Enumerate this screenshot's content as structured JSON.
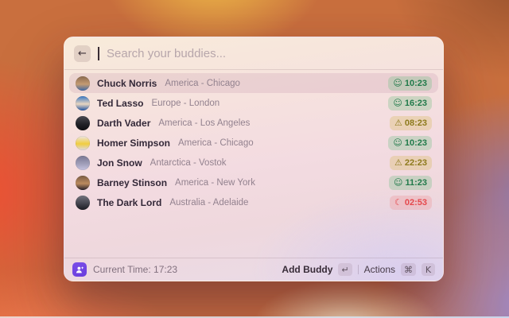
{
  "search": {
    "placeholder": "Search your buddies..."
  },
  "icons": {
    "back": "←",
    "happy": "☺",
    "warning": "⚠",
    "night": "☾"
  },
  "buddies": [
    {
      "name": "Chuck Norris",
      "location": "America - Chicago",
      "time": "10:23",
      "status": "happy",
      "selected": true,
      "avatar": [
        "#8a6a4e",
        "#c59b72",
        "#4068a4"
      ]
    },
    {
      "name": "Ted Lasso",
      "location": "Europe - London",
      "time": "16:23",
      "status": "happy",
      "selected": false,
      "avatar": [
        "#3a78c2",
        "#e8d5c0",
        "#2456a2"
      ]
    },
    {
      "name": "Darth Vader",
      "location": "America - Los Angeles",
      "time": "08:23",
      "status": "warning",
      "selected": false,
      "avatar": [
        "#4a4a52",
        "#222228",
        "#0e0e12"
      ]
    },
    {
      "name": "Homer Simpson",
      "location": "America - Chicago",
      "time": "10:23",
      "status": "happy",
      "selected": false,
      "avatar": [
        "#ece4e6",
        "#f0cd3e",
        "#dfd8e2"
      ]
    },
    {
      "name": "Jon Snow",
      "location": "Antarctica - Vostok",
      "time": "22:23",
      "status": "warning",
      "selected": false,
      "avatar": [
        "#7a7892",
        "#9f9db8",
        "#c6c2de"
      ]
    },
    {
      "name": "Barney Stinson",
      "location": "America - New York",
      "time": "11:23",
      "status": "happy",
      "selected": false,
      "avatar": [
        "#7a5c44",
        "#bb8a5e",
        "#26202a"
      ]
    },
    {
      "name": "The Dark Lord",
      "location": "Australia - Adelaide",
      "time": "02:53",
      "status": "night",
      "selected": false,
      "avatar": [
        "#74747e",
        "#44444e",
        "#1c1c22"
      ]
    }
  ],
  "status_colors": {
    "happy": {
      "text": "#217a4a",
      "bg": "rgba(110,190,130,0.30)"
    },
    "warning": {
      "text": "#8d7a1c",
      "bg": "rgba(215,185,95,0.33)"
    },
    "night": {
      "text": "#e5484d",
      "bg": "rgba(240,125,125,0.24)"
    }
  },
  "footer": {
    "current_time_label": "Current Time: 17:23",
    "add_buddy_label": "Add Buddy",
    "return_key": "↵",
    "actions_label": "Actions",
    "cmd_key": "⌘",
    "k_key": "K",
    "logo_color": "#7a4fe8"
  }
}
